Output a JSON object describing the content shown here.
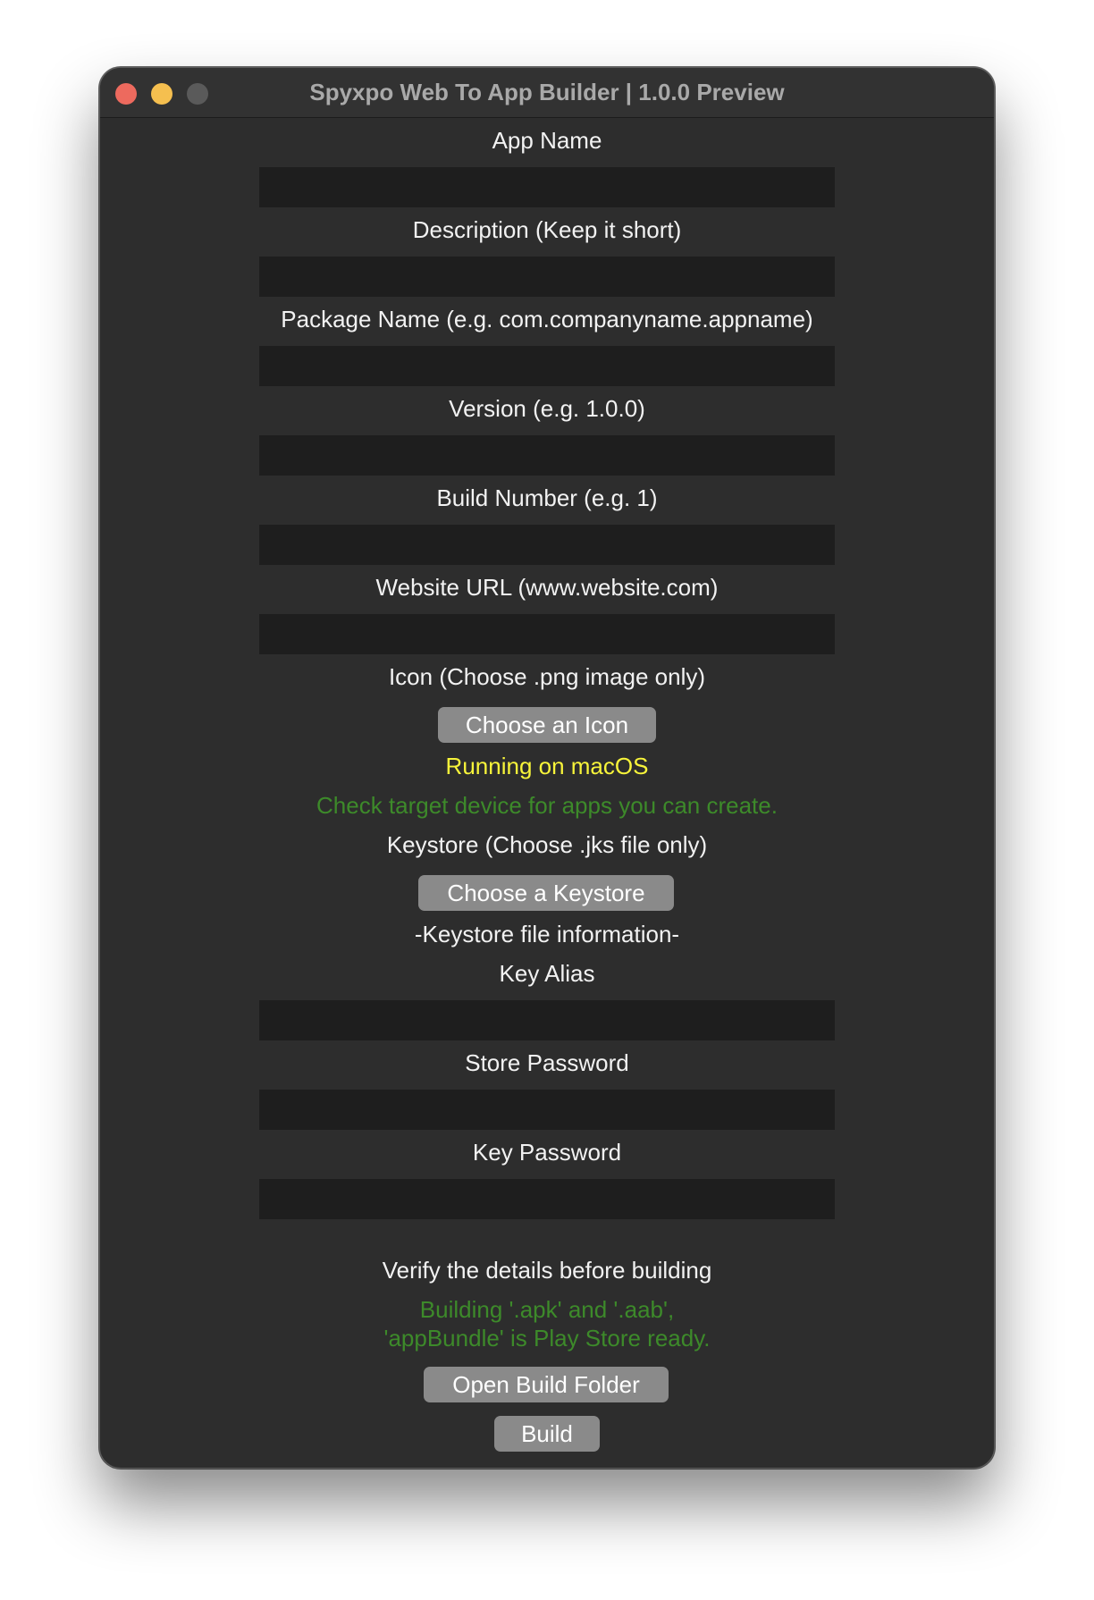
{
  "window": {
    "title": "Spyxpo Web To App Builder | 1.0.0 Preview"
  },
  "form": {
    "app_name_label": "App Name",
    "app_name_value": "",
    "description_label": "Description (Keep it short)",
    "description_value": "",
    "package_label": "Package Name (e.g. com.companyname.appname)",
    "package_value": "",
    "version_label": "Version (e.g. 1.0.0)",
    "version_value": "",
    "build_number_label": "Build Number (e.g. 1)",
    "build_number_value": "",
    "website_label": "Website URL (www.website.com)",
    "website_value": "",
    "icon_label": "Icon (Choose .png image only)",
    "choose_icon_button": "Choose an Icon",
    "running_status": "Running on macOS",
    "target_hint": "Check target device for apps you can create.",
    "keystore_label": "Keystore (Choose .jks file only)",
    "choose_keystore_button": "Choose a Keystore",
    "keystore_info_heading": "-Keystore file information-",
    "key_alias_label": "Key Alias",
    "key_alias_value": "",
    "store_password_label": "Store Password",
    "store_password_value": "",
    "key_password_label": "Key Password",
    "key_password_value": ""
  },
  "footer": {
    "verify_text": "Verify the details before building",
    "build_info_line1": "Building '.apk' and '.aab',",
    "build_info_line2": "'appBundle' is Play Store ready.",
    "open_folder_button": "Open Build Folder",
    "build_button": "Build"
  },
  "colors": {
    "window_bg": "#2d2d2d",
    "field_bg": "#1e1e1e",
    "button_bg": "#8a8a8a",
    "status_yellow": "#f7f43a",
    "hint_green": "#3d8a2a",
    "close_red": "#ed6a5e",
    "minimize_yellow": "#f5bf4f"
  }
}
